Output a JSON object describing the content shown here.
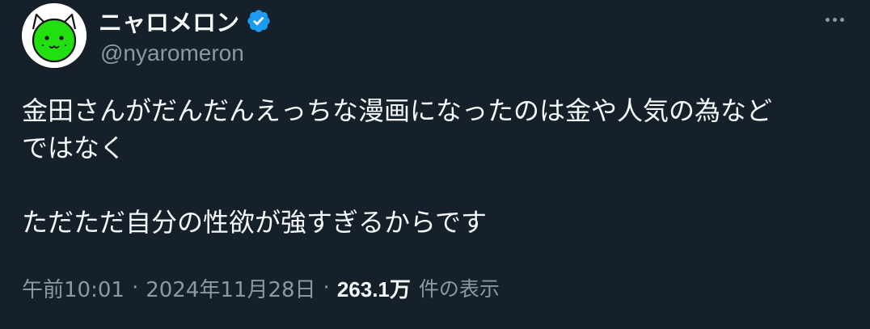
{
  "author": {
    "display_name": "ニャロメロン",
    "handle": "@nyaromeron",
    "verified": true,
    "avatar_icon": "green-cat-face-icon"
  },
  "tweet": {
    "lines": [
      "金田さんがだんだんえっちな漫画になったのは金や人気の為など",
      "ではなく",
      "",
      "ただただ自分の性欲が強すぎるからです"
    ]
  },
  "meta": {
    "time": "午前10:01",
    "separator": "·",
    "date": "2024年11月28日",
    "views_count": "263.1万",
    "views_label": "件の表示"
  },
  "colors": {
    "background": "#15202b",
    "text": "#f7f9f9",
    "secondary": "#8b98a5",
    "verified": "#1d9bf0",
    "avatar_green": "#22e00f"
  }
}
